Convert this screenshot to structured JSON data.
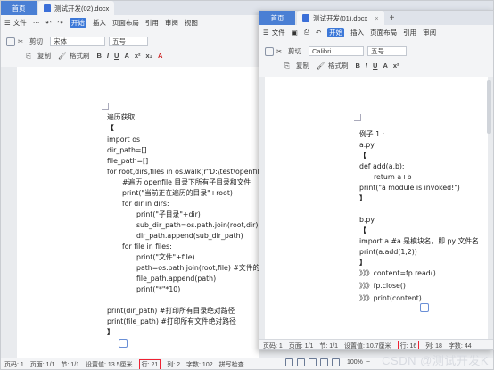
{
  "win1": {
    "tabs": {
      "home": "首页",
      "doc": "测试开发(02).docx"
    },
    "menu": [
      "文件",
      "开始",
      "插入",
      "页面布局",
      "引用",
      "审阅",
      "视图"
    ],
    "toolbar": {
      "cut": "剪切",
      "copy": "复制",
      "format_painter": "格式刷",
      "font": "宋体",
      "size": "五号"
    },
    "lines": [
      "遍历获取",
      "【",
      "import os",
      "dir_path=[]",
      "file_path=[]",
      "for root,dirs,files in os.walk(r\"D:\\test\\openfile\"):",
      "#遍历 openfile 目录下所有子目录和文件",
      "print(\"当前正在遍历的目录\"+root)",
      "for dir in dirs:",
      "print(\"子目录\"+dir)",
      "sub_dir_path=os.path.join(root,dir)    #目录",
      "dir_path.append(sub_dir_path)",
      "for file in files:",
      "print(\"文件\"+file)",
      "path=os.path.join(root,file)    #文件的绝对",
      "file_path.append(path)",
      "print(\"*\"*10)",
      "print(dir_path)       #打印所有目录绝对路径",
      "print(file_path)      #打印所有文件绝对路径",
      "】"
    ],
    "status": [
      "页码: 1",
      "页面: 1/1",
      "节: 1/1",
      "设置值: 13.5厘米",
      "行: 21",
      "列: 2",
      "字数: 102",
      "拼写检查"
    ]
  },
  "win2": {
    "tabs": {
      "home": "首页",
      "doc": "测试开发(01).docx",
      "login": "立即登录"
    },
    "menu": [
      "文件",
      "开始",
      "插入",
      "页面布局",
      "引用",
      "审阅"
    ],
    "toolbar": {
      "cut": "剪切",
      "copy": "复制",
      "format_painter": "格式刷",
      "font": "Calibri",
      "size": "五号"
    },
    "lines": [
      "例子 1 :",
      "a.py",
      "【",
      "def add(a,b):",
      "return a+b",
      "print(\"a module is invoked!\")",
      "】",
      "b.py",
      "【",
      "import a    #a 是模块名，即 py 文件名",
      "print(a.add(1,2))",
      "】",
      "》》》content=fp.read()",
      "》》》fp.close()",
      "》》》print(content)"
    ],
    "status": [
      "页码: 1",
      "页面: 1/1",
      "节: 1/1",
      "设置值: 10.7厘米",
      "行: 16",
      "列: 18",
      "字数: 44"
    ],
    "zoom": "100%",
    "watermark": "CSDN @测试开发K"
  }
}
